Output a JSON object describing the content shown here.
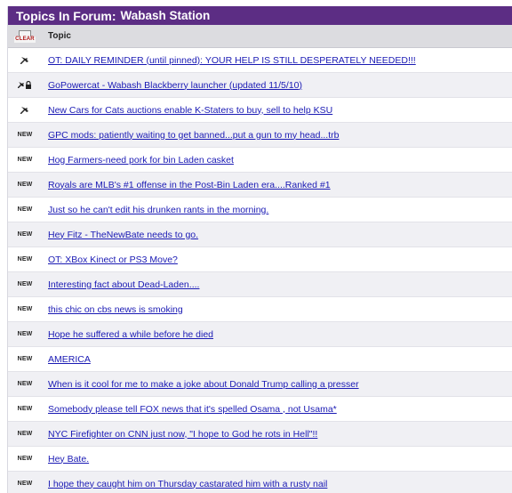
{
  "forum": {
    "title_prefix": "Topics In Forum:",
    "forum_name": "Wabash Station",
    "accent_color": "#5c2d84"
  },
  "header": {
    "clear_icon_label": "CLEAR",
    "topic_column": "Topic"
  },
  "topics": [
    {
      "status": "pinned",
      "title": "OT: DAILY REMINDER (until pinned): YOUR HELP IS STILL DESPERATELY NEEDED!!!"
    },
    {
      "status": "pinned-locked",
      "title": "GoPowercat - Wabash Blackberry launcher (updated 11/5/10)"
    },
    {
      "status": "pinned",
      "title": "New Cars for Cats auctions enable K-Staters to buy, sell to help KSU"
    },
    {
      "status": "new",
      "status_label": "NEW",
      "title": "GPC mods: patiently waiting to get banned...put a gun to my head...trb"
    },
    {
      "status": "new",
      "status_label": "NEW",
      "title": "Hog Farmers-need pork for bin Laden casket"
    },
    {
      "status": "new",
      "status_label": "NEW",
      "title": "Royals are MLB's #1 offense in the Post-Bin Laden era....Ranked #1"
    },
    {
      "status": "new",
      "status_label": "NEW",
      "title": "Just so he can't edit his drunken rants in the morning."
    },
    {
      "status": "new",
      "status_label": "NEW",
      "title": "Hey Fitz - TheNewBate needs to go."
    },
    {
      "status": "new",
      "status_label": "NEW",
      "title": "OT: XBox Kinect or PS3 Move?"
    },
    {
      "status": "new",
      "status_label": "NEW",
      "title": "Interesting fact about Dead-Laden...."
    },
    {
      "status": "new",
      "status_label": "NEW",
      "title": "this chic on cbs news is smoking"
    },
    {
      "status": "new",
      "status_label": "NEW",
      "title": "Hope he suffered a while before he died"
    },
    {
      "status": "new",
      "status_label": "NEW",
      "title": "AMERICA"
    },
    {
      "status": "new",
      "status_label": "NEW",
      "title": "When is it cool for me to make a joke about Donald Trump calling a presser"
    },
    {
      "status": "new",
      "status_label": "NEW",
      "title": "Somebody please tell FOX news that it's spelled Osama , not Usama*"
    },
    {
      "status": "new",
      "status_label": "NEW",
      "title": "NYC Firefighter on CNN just now, \"I hope to God he rots in Hell\"!!"
    },
    {
      "status": "new",
      "status_label": "NEW",
      "title": "Hey Bate."
    },
    {
      "status": "new",
      "status_label": "NEW",
      "title": "I hope they caught him on Thursday castarated him with a rusty nail"
    }
  ]
}
